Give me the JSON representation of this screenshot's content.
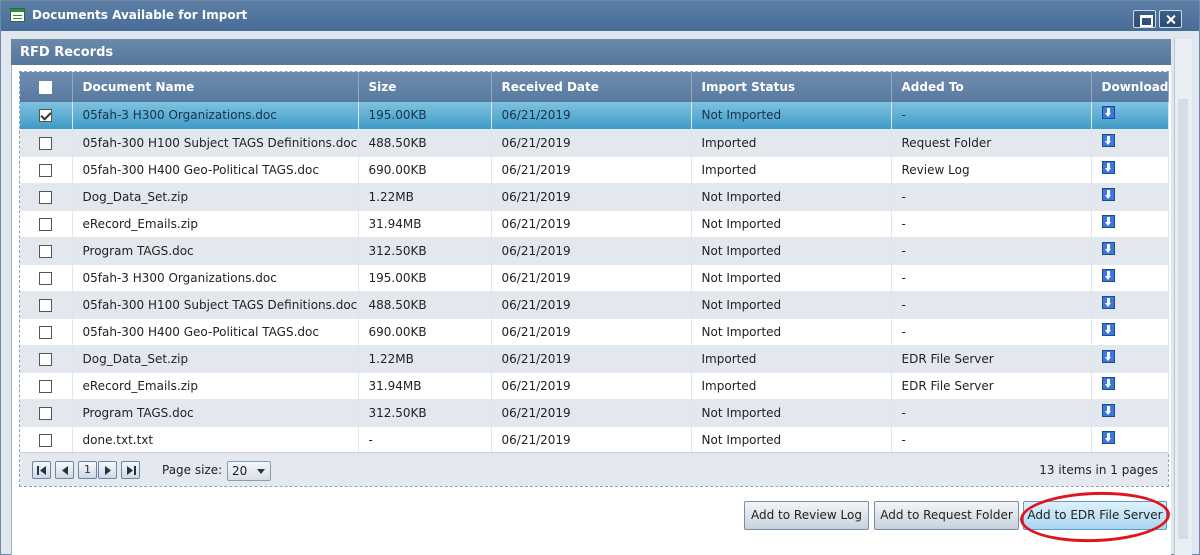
{
  "window": {
    "title": "Documents Available for Import"
  },
  "panel": {
    "title": "RFD Records"
  },
  "columns": [
    "Document Name",
    "Size",
    "Received Date",
    "Import Status",
    "Added To",
    "Download"
  ],
  "rows": [
    {
      "name": "05fah-3 H300 Organizations.doc",
      "size": "195.00KB",
      "date": "06/21/2019",
      "status": "Not Imported",
      "added": "-",
      "checked": true
    },
    {
      "name": "05fah-300 H100 Subject TAGS Definitions.doc",
      "size": "488.50KB",
      "date": "06/21/2019",
      "status": "Imported",
      "added": "Request Folder",
      "checked": false
    },
    {
      "name": "05fah-300 H400 Geo-Political TAGS.doc",
      "size": "690.00KB",
      "date": "06/21/2019",
      "status": "Imported",
      "added": "Review Log",
      "checked": false
    },
    {
      "name": "Dog_Data_Set.zip",
      "size": "1.22MB",
      "date": "06/21/2019",
      "status": "Not Imported",
      "added": "-",
      "checked": false
    },
    {
      "name": "eRecord_Emails.zip",
      "size": "31.94MB",
      "date": "06/21/2019",
      "status": "Not Imported",
      "added": "-",
      "checked": false
    },
    {
      "name": "Program TAGS.doc",
      "size": "312.50KB",
      "date": "06/21/2019",
      "status": "Not Imported",
      "added": "-",
      "checked": false
    },
    {
      "name": "05fah-3 H300 Organizations.doc",
      "size": "195.00KB",
      "date": "06/21/2019",
      "status": "Not Imported",
      "added": "-",
      "checked": false
    },
    {
      "name": "05fah-300 H100 Subject TAGS Definitions.doc",
      "size": "488.50KB",
      "date": "06/21/2019",
      "status": "Not Imported",
      "added": "-",
      "checked": false
    },
    {
      "name": "05fah-300 H400 Geo-Political TAGS.doc",
      "size": "690.00KB",
      "date": "06/21/2019",
      "status": "Not Imported",
      "added": "-",
      "checked": false
    },
    {
      "name": "Dog_Data_Set.zip",
      "size": "1.22MB",
      "date": "06/21/2019",
      "status": "Imported",
      "added": "EDR File Server",
      "checked": false
    },
    {
      "name": "eRecord_Emails.zip",
      "size": "31.94MB",
      "date": "06/21/2019",
      "status": "Imported",
      "added": "EDR File Server",
      "checked": false
    },
    {
      "name": "Program TAGS.doc",
      "size": "312.50KB",
      "date": "06/21/2019",
      "status": "Not Imported",
      "added": "-",
      "checked": false
    },
    {
      "name": "done.txt.txt",
      "size": "-",
      "date": "06/21/2019",
      "status": "Not Imported",
      "added": "-",
      "checked": false
    }
  ],
  "pager": {
    "current_page": "1",
    "page_size_label": "Page size:",
    "page_size": "20",
    "items_count": "13",
    "items_text": "items in",
    "pages_count": "1",
    "pages_text": "pages"
  },
  "actions": {
    "review_log": "Add to Review Log",
    "request_folder": "Add to Request Folder",
    "edr_server": "Add to EDR File Server"
  },
  "colors": {
    "header": "#587aa0",
    "selected_row": "#3f9ac6",
    "highlight_ring": "#e0141e"
  }
}
